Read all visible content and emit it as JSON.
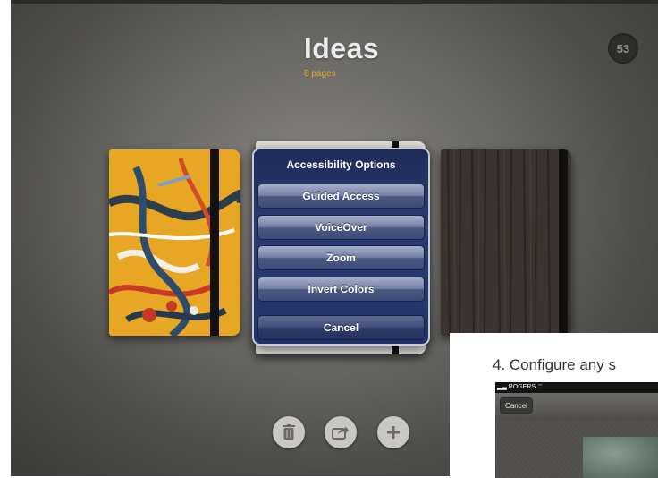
{
  "app": {
    "title": "Ideas",
    "subtitle": "8 pages",
    "avatar_label": "53"
  },
  "modal": {
    "title": "Accessibility Options",
    "buttons": [
      "Guided Access",
      "VoiceOver",
      "Zoom",
      "Invert Colors"
    ],
    "cancel": "Cancel"
  },
  "toolbar": {
    "icons": [
      "trash-icon",
      "share-icon",
      "plus-icon"
    ]
  },
  "inset": {
    "caption": "4.  Configure any s",
    "carrier": "ROGERS",
    "cancel": "Cancel"
  },
  "colors": {
    "subtitle": "#e8b020",
    "modal_bg": "#2b3a72",
    "modal_button": "#5a668f"
  }
}
